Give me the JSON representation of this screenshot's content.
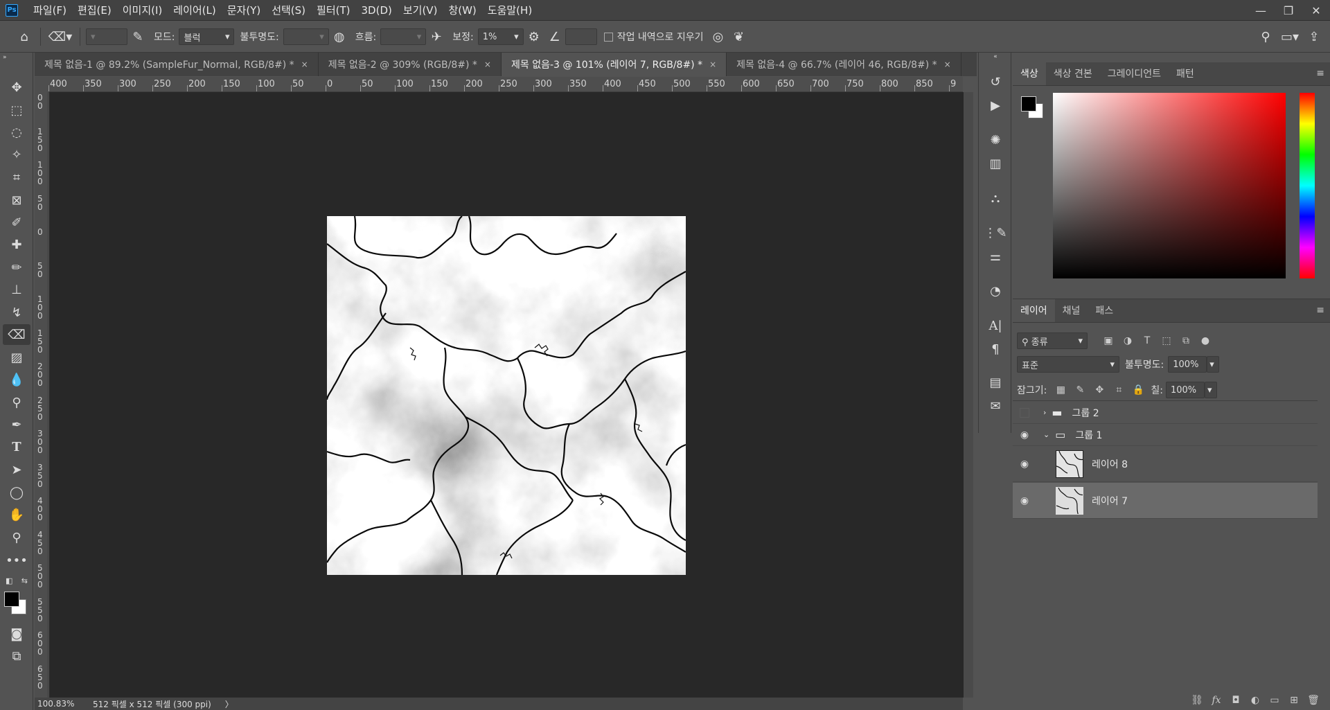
{
  "menubar": {
    "logo": "Ps",
    "items": [
      "파일(F)",
      "편집(E)",
      "이미지(I)",
      "레이어(L)",
      "문자(Y)",
      "선택(S)",
      "필터(T)",
      "3D(D)",
      "보기(V)",
      "창(W)",
      "도움말(H)"
    ],
    "window_controls": [
      "—",
      "❐",
      "✕"
    ]
  },
  "options": {
    "mode_label": "모드:",
    "mode_value": "블럭",
    "opacity_label": "불투명도:",
    "flow_label": "흐름:",
    "smoothing_label": "보정:",
    "smoothing_value": "1%",
    "erase_history_label": "작업 내역으로 지우기"
  },
  "tabs": [
    {
      "label": "제목 없음-1 @ 89.2% (SampleFur_Normal, RGB/8#) *",
      "close": "×"
    },
    {
      "label": "제목 없음-2 @ 309% (RGB/8#) *",
      "close": "×"
    },
    {
      "label": "제목 없음-3 @ 101% (레이어 7, RGB/8#) *",
      "close": "×"
    },
    {
      "label": "제목 없음-4 @ 66.7% (레이어 46, RGB/8#) *",
      "close": "×"
    }
  ],
  "ruler": {
    "h_ticks": [
      "400",
      "350",
      "300",
      "250",
      "200",
      "150",
      "100",
      "50",
      "0",
      "50",
      "100",
      "150",
      "200",
      "250",
      "300",
      "350",
      "400",
      "450",
      "500",
      "550",
      "600",
      "650",
      "700",
      "750",
      "800",
      "850",
      "9"
    ],
    "v_ticks": [
      "0\n0",
      "1\n5\n0",
      "1\n0\n0",
      "5\n0",
      "0",
      "5\n0",
      "1\n0\n0",
      "1\n5\n0",
      "2\n0\n0",
      "2\n5\n0",
      "3\n0\n0",
      "3\n5\n0",
      "4\n0\n0",
      "4\n5\n0",
      "5\n0\n0",
      "5\n5\n0",
      "6\n0\n0",
      "6\n5\n0"
    ]
  },
  "status": {
    "zoom": "100.83%",
    "doc_info": "512 픽셀 x 512 픽셀 (300 ppi)",
    "arrow": "〉"
  },
  "color_panel": {
    "tabs": [
      "색상",
      "색상 견본",
      "그레이디언트",
      "패턴"
    ],
    "foreground": "#000000",
    "background": "#ffffff"
  },
  "layers_panel": {
    "tabs": [
      "레이어",
      "채널",
      "패스"
    ],
    "filter_kind": "종류",
    "blend_mode": "표준",
    "opacity_label": "불투명도:",
    "opacity_value": "100%",
    "lock_label": "잠그기:",
    "fill_label": "칠:",
    "fill_value": "100%",
    "layers": [
      {
        "name": "그룹 2",
        "type": "group",
        "visible": false,
        "expanded": false
      },
      {
        "name": "그룹 1",
        "type": "group",
        "visible": true,
        "expanded": true
      },
      {
        "name": "레이어 8",
        "type": "layer",
        "visible": true,
        "selected": false
      },
      {
        "name": "레이어 7",
        "type": "layer",
        "visible": true,
        "selected": true
      }
    ]
  }
}
